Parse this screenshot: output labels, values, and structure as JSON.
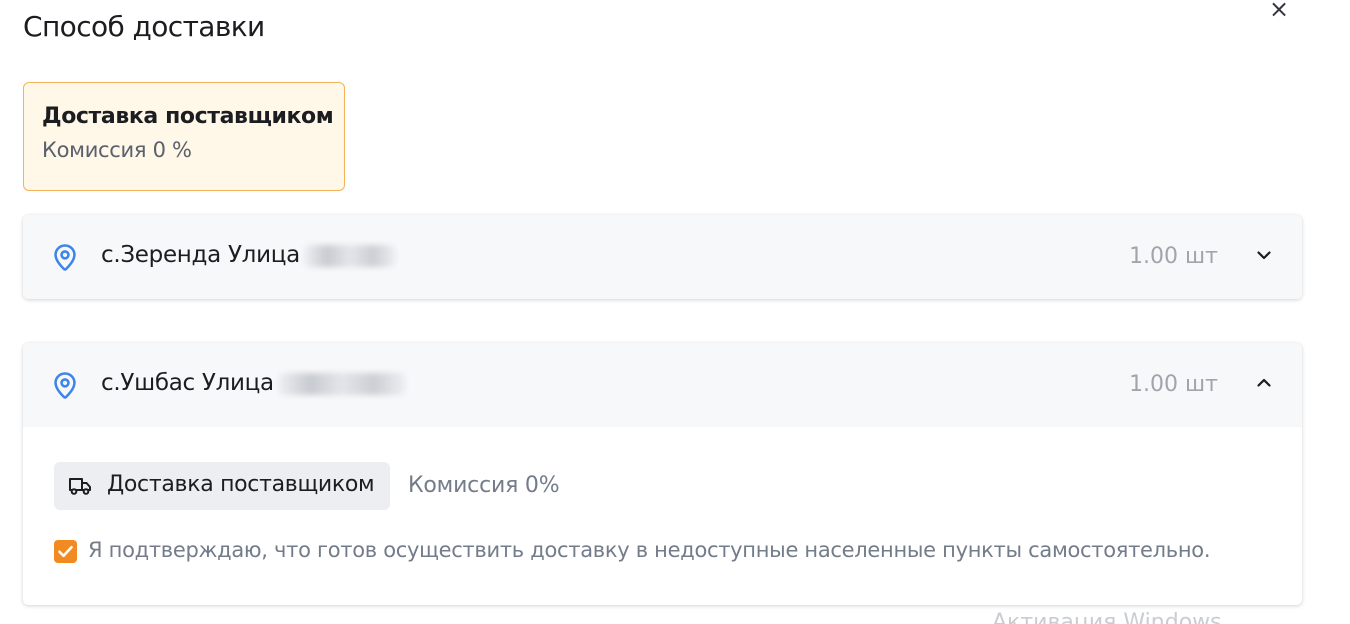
{
  "header": {
    "title": "Способ доставки",
    "close_icon": "close-icon"
  },
  "method_card": {
    "title": "Доставка поставщиком",
    "commission": "Комиссия 0 %"
  },
  "addresses": [
    {
      "label": "с.Зеренда Улица",
      "quantity": "1.00 шт",
      "expanded": false,
      "icon": "map-pin-icon"
    },
    {
      "label": "с.Ушбас Улица",
      "quantity": "1.00 шт",
      "expanded": true,
      "icon": "map-pin-icon",
      "delivery": {
        "label": "Доставка поставщиком",
        "commission": "Комиссия 0%",
        "icon": "truck-icon"
      },
      "confirm": {
        "checked": true,
        "label": "Я подтверждаю, что готов осуществить доставку в недоступные населенные пункты самостоятельно."
      }
    }
  ],
  "watermark": "Активация Windows",
  "colors": {
    "accent": "#f28a22",
    "pin": "#3f84e8",
    "card_border": "#f4b25b",
    "card_bg": "#fff7e8",
    "muted": "#737c8a"
  }
}
